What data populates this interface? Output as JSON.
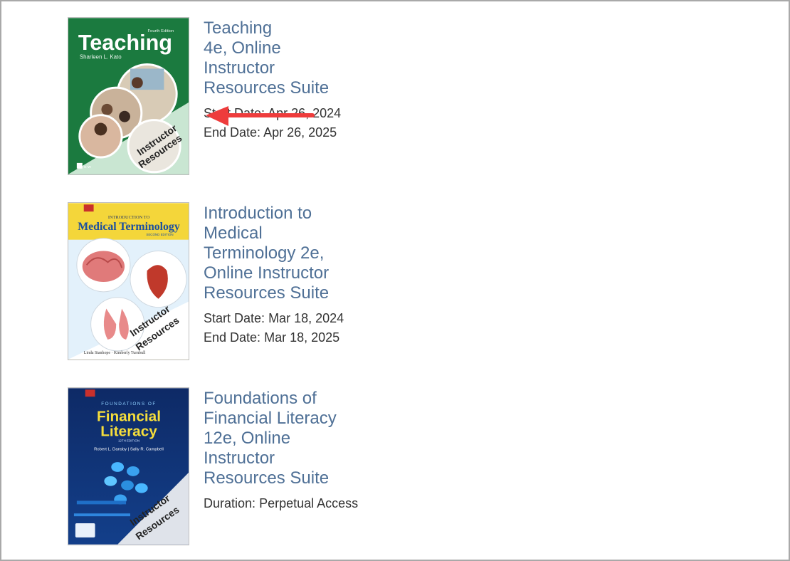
{
  "products": [
    {
      "title": "Teaching 4e,",
      "subtitle": "Online Instructor Resources Suite",
      "start_label": "Start Date:",
      "start_value": "Apr 26, 2024",
      "end_label": "End Date:",
      "end_value": "Apr 26, 2025",
      "cover": {
        "title": "Teaching",
        "edition": "Fourth Edition",
        "author": "Sharleen L. Kato",
        "badge": "Instructor Resources",
        "bg_color": "#1b7a3f"
      }
    },
    {
      "title": "Introduction to Medical Terminology 2e, Online Instructor",
      "title_line2": "Resources Suite",
      "start_label": "Start Date:",
      "start_value": "Mar 18, 2024",
      "end_label": "End Date:",
      "end_value": "Mar 18, 2025",
      "cover": {
        "kicker": "INTRODUCTION TO",
        "title": "Medical Terminology",
        "edition": "SECOND EDITION",
        "author": "Linda Stanhope · Kimberly Turnbull",
        "badge": "Instructor Resources",
        "bg_color": "#f4d63a"
      }
    },
    {
      "title": "Foundations of Financial Literacy 12e,",
      "subtitle": "Online Instructor Resources Suite",
      "duration_label": "Duration:",
      "duration_value": "Perpetual Access",
      "cover": {
        "kicker": "FOUNDATIONS OF",
        "title_line1": "Financial",
        "title_line2": "Literacy",
        "edition": "12TH EDITION",
        "author": "Robert L. Dansby | Sally R. Campbell",
        "badge": "Instructor Resources",
        "bg_color": "#0e2a66"
      }
    }
  ],
  "annotation": {
    "arrow_color": "#ee3c3c"
  },
  "colors": {
    "link": "#4f7096",
    "text": "#333333"
  }
}
